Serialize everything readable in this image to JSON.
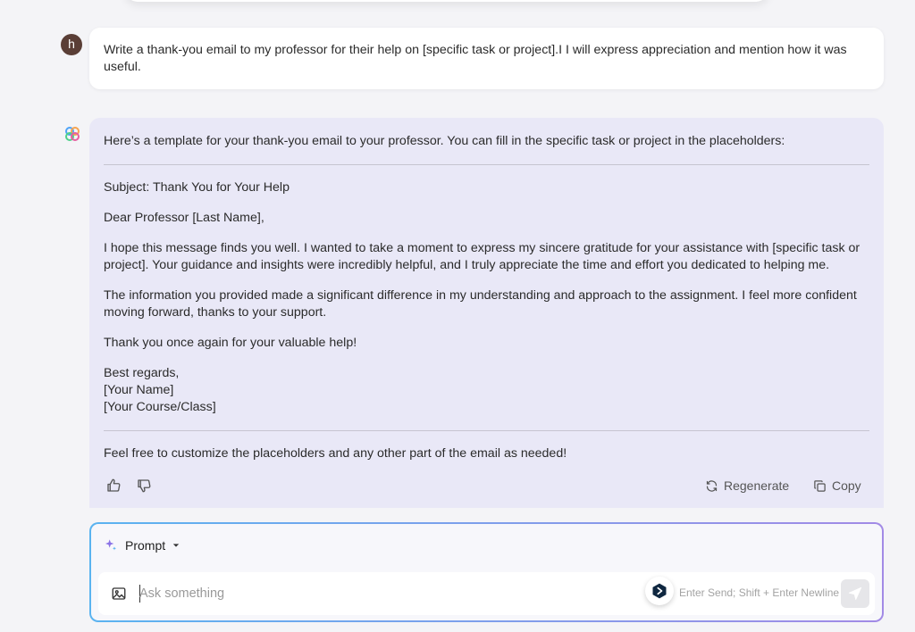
{
  "user": {
    "avatar_letter": "h",
    "message": "Write a thank-you email to my professor for their help on [specific task or project].I I will express appreciation and mention how it was useful."
  },
  "assistant": {
    "intro": "Here’s a template for your thank-you email to your professor. You can fill in the specific task or project in the placeholders:",
    "subject": "Subject: Thank You for Your Help",
    "greeting": "Dear Professor [Last Name],",
    "para1": "I hope this message finds you well. I wanted to take a moment to express my sincere gratitude for your assistance with [specific task or project]. Your guidance and insights were incredibly helpful, and I truly appreciate the time and effort you dedicated to helping me.",
    "para2": "The information you provided made a significant difference in my understanding and approach to the assignment. I feel more confident moving forward, thanks to your support.",
    "para3": "Thank you once again for your valuable help!",
    "signoff": "Best regards,",
    "sign_name": "[Your Name]",
    "sign_course": "[Your Course/Class]",
    "closing": "Feel free to customize the placeholders and any other part of the email as needed!",
    "actions": {
      "regenerate": "Regenerate",
      "copy": "Copy"
    }
  },
  "composer": {
    "mode_label": "Prompt",
    "placeholder": "Ask something",
    "hint": "Enter Send; Shift + Enter Newline"
  },
  "colors": {
    "assistant_bg": "#e9e8f7",
    "avatar_bg": "#5a3e36",
    "composer_border_start": "#5ab3f0",
    "composer_border_end": "#a28ae6"
  }
}
